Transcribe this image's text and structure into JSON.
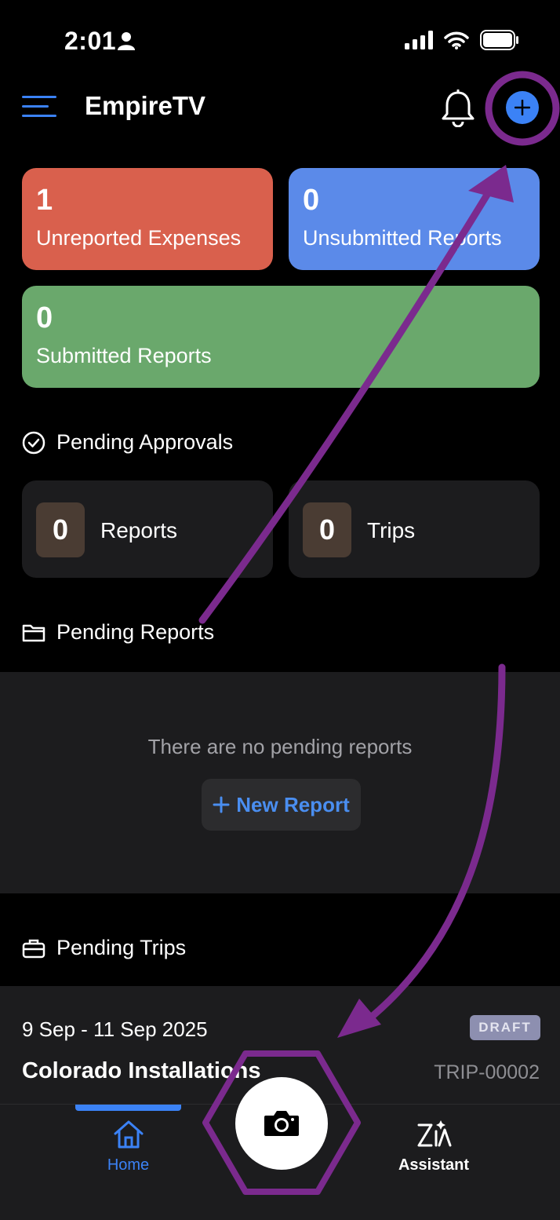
{
  "status_bar": {
    "time": "2:01"
  },
  "header": {
    "title": "EmpireTV"
  },
  "stats": [
    {
      "count": "1",
      "label": "Unreported Expenses"
    },
    {
      "count": "0",
      "label": "Unsubmitted Reports"
    },
    {
      "count": "0",
      "label": "Submitted Reports"
    }
  ],
  "pending_approvals": {
    "title": "Pending Approvals",
    "items": [
      {
        "count": "0",
        "label": "Reports"
      },
      {
        "count": "0",
        "label": "Trips"
      }
    ]
  },
  "pending_reports": {
    "title": "Pending Reports",
    "empty_text": "There are no pending reports",
    "new_report_label": "New Report"
  },
  "pending_trips": {
    "title": "Pending Trips",
    "items": [
      {
        "dates": "9 Sep - 11 Sep 2025",
        "status": "DRAFT",
        "name": "Colorado Installations",
        "id": "TRIP-00002"
      }
    ]
  },
  "tabs": {
    "home": "Home",
    "assistant": "Assistant"
  },
  "colors": {
    "accent": "#3b82f6",
    "unreported": "#d9604d",
    "unsubmitted": "#5b8ae9",
    "submitted": "#6aa86c",
    "annotation": "#7b2a8e"
  }
}
